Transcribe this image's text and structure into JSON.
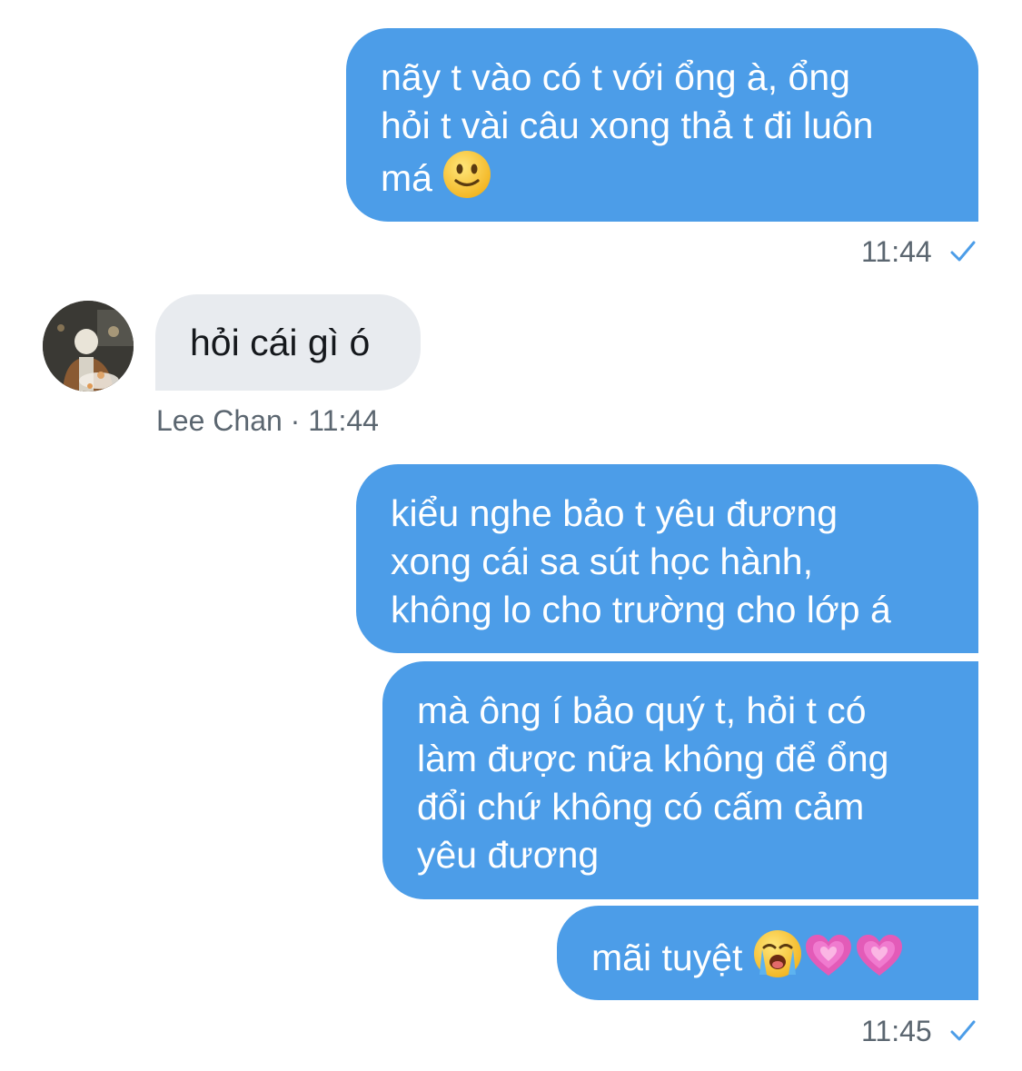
{
  "conversation": {
    "messages": [
      {
        "id": "m1",
        "direction": "outgoing",
        "text_prefix": "nãy t vào có t với ổng à, ổng\nhỏi t vài câu xong thả t đi luôn\nmá ",
        "emojis": [
          "slightly-smiling-face"
        ],
        "time": "11:44",
        "status": "sent-check"
      },
      {
        "id": "m2",
        "direction": "incoming",
        "text": "hỏi cái gì ó",
        "sender": "Lee Chan",
        "separator": "·",
        "time": "11:44"
      },
      {
        "id": "m3",
        "direction": "outgoing",
        "text": "kiểu nghe bảo t yêu đương\nxong cái sa sút học hành,\nkhông lo cho trường cho lớp á"
      },
      {
        "id": "m4",
        "direction": "outgoing",
        "text": "mà ông í bảo quý t, hỏi t có\nlàm được nữa không để ổng\nđổi chứ không có cấm cảm\nyêu đương"
      },
      {
        "id": "m5",
        "direction": "outgoing",
        "text_prefix": "mãi tuyệt ",
        "emojis": [
          "loudly-crying-face",
          "growing-heart",
          "growing-heart"
        ],
        "time": "11:45",
        "status": "sent-check"
      }
    ],
    "colors": {
      "outgoing_bubble": "#4c9de8",
      "incoming_bubble": "#e8ebef",
      "check_mark": "#4c9de8",
      "meta_text": "#5b6670"
    },
    "icons": {
      "read_receipt": "checkmark-icon",
      "avatar": "contact-avatar"
    }
  }
}
